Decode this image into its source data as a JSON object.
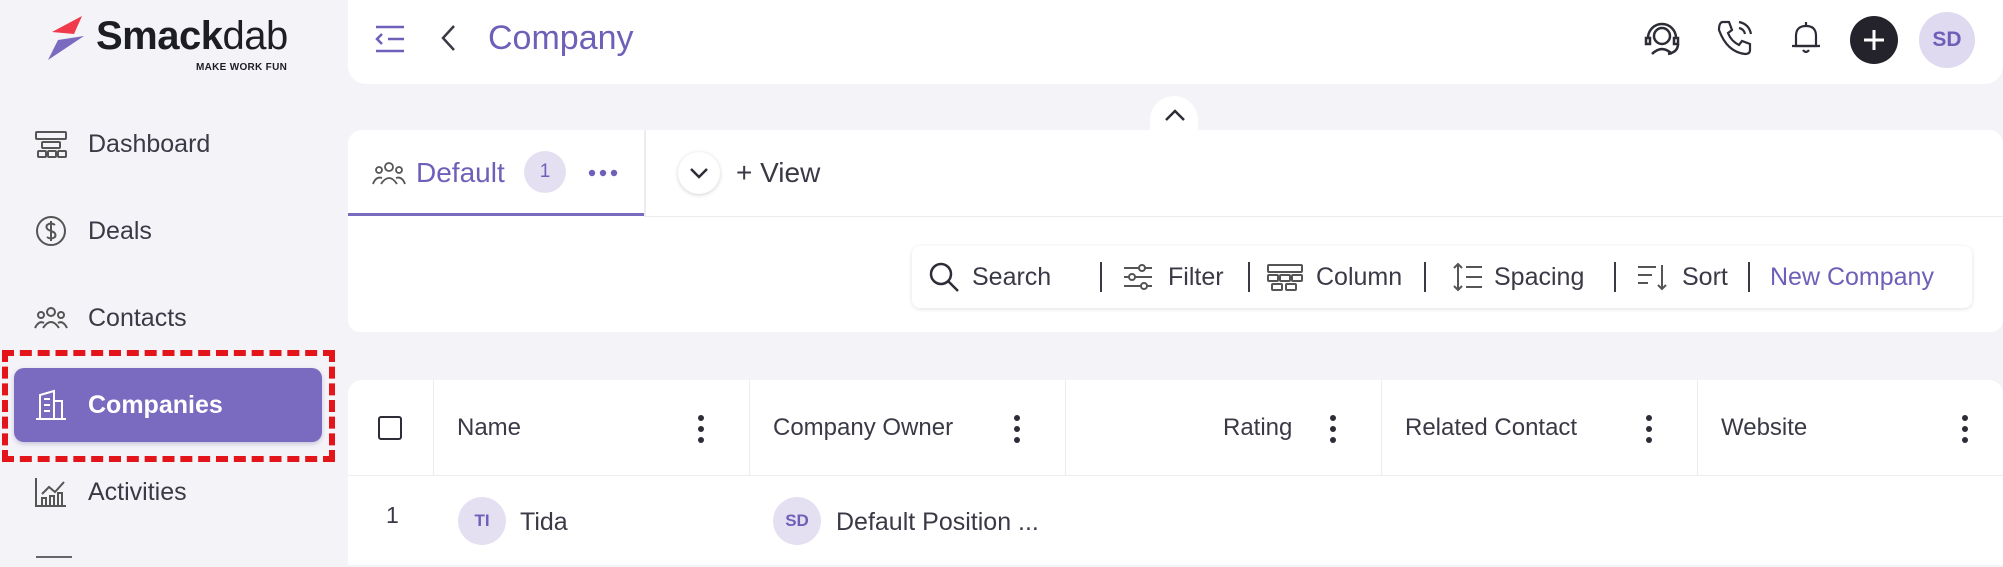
{
  "brand": {
    "name_bold": "Smack",
    "name_light": "dab",
    "tagline": "MAKE WORK FUN",
    "accent": "#7a6bc0",
    "highlight_color": "#e3141a"
  },
  "sidebar": {
    "items": [
      {
        "label": "Dashboard",
        "icon": "dashboard-icon",
        "active": false
      },
      {
        "label": "Deals",
        "icon": "dollar-icon",
        "active": false
      },
      {
        "label": "Contacts",
        "icon": "contacts-icon",
        "active": false
      },
      {
        "label": "Companies",
        "icon": "building-icon",
        "active": true
      },
      {
        "label": "Activities",
        "icon": "activities-icon",
        "active": false
      }
    ]
  },
  "header": {
    "title": "Company",
    "icons": [
      "menu-collapse-icon",
      "back-icon",
      "support-icon",
      "phone-icon",
      "bell-icon",
      "plus-icon"
    ],
    "avatar_initials": "SD"
  },
  "views": {
    "tabs": [
      {
        "label": "Default",
        "count": "1",
        "icon": "group-icon",
        "active": true
      }
    ],
    "add_view_label": "+ View"
  },
  "toolbar": {
    "search_label": "Search",
    "filter_label": "Filter",
    "column_label": "Column",
    "spacing_label": "Spacing",
    "sort_label": "Sort",
    "new_company_label": "New Company"
  },
  "table": {
    "columns": [
      "Name",
      "Company Owner",
      "Rating",
      "Related Contact",
      "Website"
    ],
    "rows": [
      {
        "index": "1",
        "name_initials": "TI",
        "name": "Tida",
        "owner_initials": "SD",
        "owner": "Default Position ..."
      }
    ]
  }
}
